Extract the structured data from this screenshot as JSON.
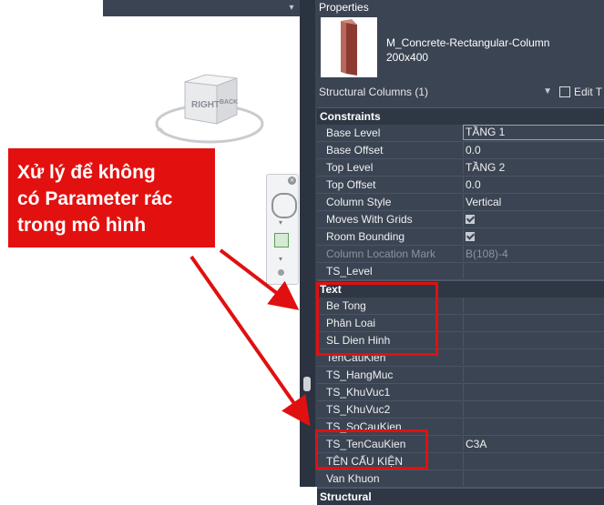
{
  "panel": {
    "title": "Properties",
    "type_name_line1": "M_Concrete-Rectangular-Column",
    "type_name_line2": "200x400",
    "selector_label": "Structural Columns (1)",
    "edit_type_label": "Edit T"
  },
  "viewcube": {
    "face_right": "RIGHT",
    "face_back": "BACK"
  },
  "groups": {
    "constraints": "Constraints",
    "text": "Text",
    "structural": "Structural"
  },
  "constraints_rows": [
    {
      "name": "Base Level",
      "value": "TẦNG 1"
    },
    {
      "name": "Base Offset",
      "value": "0.0"
    },
    {
      "name": "Top Level",
      "value": "TẦNG 2"
    },
    {
      "name": "Top Offset",
      "value": "0.0"
    },
    {
      "name": "Column Style",
      "value": "Vertical"
    },
    {
      "name": "Moves With Grids",
      "value": "checked"
    },
    {
      "name": "Room Bounding",
      "value": "checked"
    },
    {
      "name": "Column Location Mark",
      "value": "B(108)-4"
    },
    {
      "name": "TS_Level",
      "value": ""
    }
  ],
  "text_rows": [
    {
      "name": "Be Tong",
      "value": ""
    },
    {
      "name": "Phân Loai",
      "value": ""
    },
    {
      "name": "SL Dien Hinh",
      "value": ""
    },
    {
      "name": "TenCauKien",
      "value": ""
    },
    {
      "name": "TS_HangMuc",
      "value": ""
    },
    {
      "name": "TS_KhuVuc1",
      "value": ""
    },
    {
      "name": "TS_KhuVuc2",
      "value": ""
    },
    {
      "name": "TS_SoCauKien",
      "value": ""
    },
    {
      "name": "TS_TenCauKien",
      "value": "C3A"
    },
    {
      "name": "TÊN CẤU KIỆN",
      "value": ""
    },
    {
      "name": "Van Khuon",
      "value": ""
    }
  ],
  "callout": {
    "text": "Xử lý để không\ncó Parameter rác\ntrong mô hình"
  },
  "colors": {
    "panel_bg": "#3b4453",
    "highlight_red": "#e01010",
    "callout_red": "#e31010"
  }
}
